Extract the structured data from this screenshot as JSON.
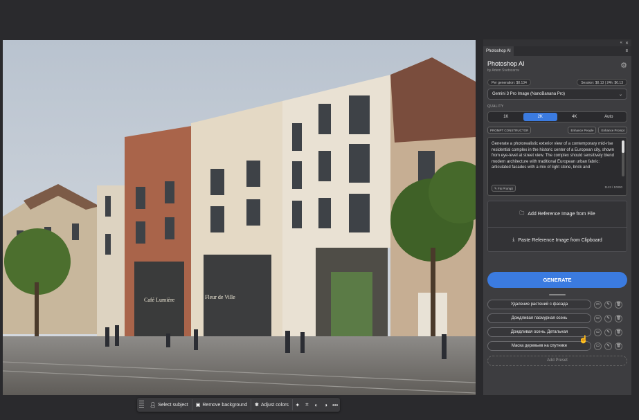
{
  "panel": {
    "tab_label": "Photoshop AI",
    "collapse_icon": "double-chevron-icon",
    "close_icon": "close-icon",
    "menu_icon": "hamburger-icon",
    "title": "Photoshop AI",
    "author": "by Artem Svetozarov",
    "settings_icon": "gear-icon",
    "per_generation": "Per generation: $0.134",
    "session": "Session: $0.13 | 24h: $0.13",
    "model": "Gemini 3 Pro Image (NanoBanana Pro)",
    "quality_label": "QUALITY",
    "quality_options": [
      "1K",
      "2K",
      "4K",
      "Auto"
    ],
    "quality_selected": "2K",
    "prompt_constructor": "PROMPT CONSTRUCTOR",
    "enhance_people": "Enhance People",
    "enhance_prompt": "Enhance Prompt",
    "prompt_text": "Generate a photorealistic exterior view of a contemporary mid-rise residential complex in the historic center of a European city, shown from eye-level at street view. The complex should sensitively blend modern architecture with traditional European urban fabric: articulated facades with a mix of light stone, brick and",
    "fix_prompt": "Fix Prompt",
    "char_count": "1113 / 10000",
    "add_ref_file": "Add Reference Image from File",
    "paste_ref_clipboard": "Paste Reference Image from Clipboard",
    "generate": "GENERATE",
    "presets": [
      "Удаление растений с фасада",
      "Дождливая пасмурная осень",
      "Дождливая осень. Детальная",
      "Маска деревьев на спутнике"
    ],
    "add_preset": "Add Preset"
  },
  "taskbar": {
    "select_subject": "Select subject",
    "remove_background": "Remove background",
    "adjust_colors": "Adjust colors",
    "more": "•••"
  },
  "image": {
    "sign_left": "Café Lumière",
    "sign_right": "Fleur de Ville"
  },
  "colors": {
    "accent": "#3b7be0",
    "panel_bg": "#3d3d40",
    "app_bg": "#2a2a2d"
  }
}
